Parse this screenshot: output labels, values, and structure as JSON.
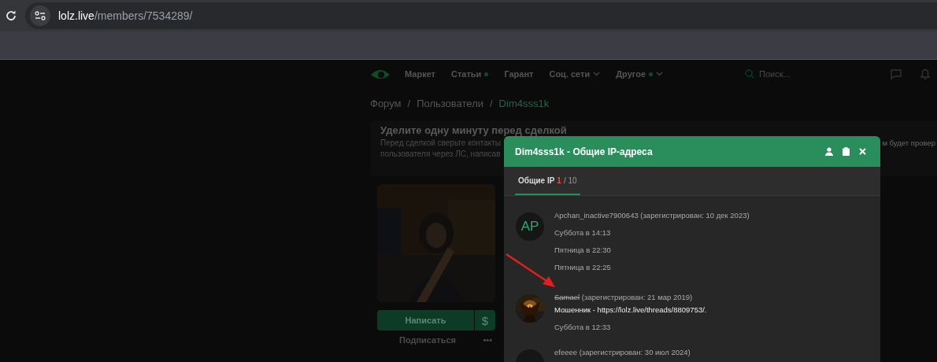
{
  "browser": {
    "url": {
      "host": "lolz.live",
      "path": "/members/7534289/"
    }
  },
  "site": {
    "nav": [
      {
        "label": "Маркет",
        "dot": false,
        "dropdown": false
      },
      {
        "label": "Статьи",
        "dot": true,
        "dropdown": false
      },
      {
        "label": "Гарант",
        "dot": false,
        "dropdown": false
      },
      {
        "label": "Соц. сети",
        "dot": false,
        "dropdown": true
      },
      {
        "label": "Другое",
        "dot": true,
        "dropdown": true
      }
    ],
    "search": {
      "placeholder": "Поиск..."
    },
    "breadcrumbs": [
      {
        "kind": "link",
        "label": "Форум",
        "selected": false
      },
      {
        "kind": "separator",
        "label": "/"
      },
      {
        "kind": "link",
        "label": "Пользователи",
        "selected": false
      },
      {
        "kind": "separator",
        "label": "/"
      },
      {
        "kind": "link",
        "label": "Dim4sss1k",
        "selected": true
      }
    ],
    "notice": {
      "title": "Уделите одну минуту перед сделкой",
      "lines": [
        {
          "left": "Перед сделкой сверьте контакты",
          "right": "м будет провер"
        },
        {
          "left": "пользователя через ЛС, написав"
        }
      ]
    },
    "profile": {
      "photo": {
        "kind": "picture"
      },
      "buttons": [
        {
          "label": "Написать",
          "kind": "primary"
        },
        {
          "label": "$",
          "kind": "side"
        },
        {
          "label": "Подписаться",
          "kind": "link"
        },
        {
          "label": "•••",
          "kind": "more"
        }
      ]
    }
  },
  "modal": {
    "title": "Dim4sss1k - Общие IP-адреса",
    "tabs": [
      {
        "label": "Общие IP",
        "count": "1",
        "total": "/ 10",
        "selected": true
      }
    ],
    "entries": [
      {
        "avatar": {
          "kind": "initials",
          "text": "AP"
        },
        "username": "Apchan_inactive7900643",
        "banned": false,
        "registered": "(зарегистрирован: 10 дек 2023)",
        "times": [
          "Суббота в 14:13",
          "Пятница в 22:30",
          "Пятница в 22:25"
        ]
      },
      {
        "avatar": {
          "kind": "picture"
        },
        "username": "Samael",
        "banned": true,
        "registered": "(зарегистрирован: 21 мар 2019)",
        "note": "Мошенник - https://lolz.live/threads/8809753/.",
        "times": [
          "Суббота в 12:33"
        ]
      },
      {
        "avatar": {
          "kind": "blank"
        },
        "username": "efeeee",
        "banned": false,
        "registered": "(зарегистрирован: 30 июл 2024)"
      }
    ]
  },
  "annotation": {
    "kind": "arrow",
    "color": "#e02020"
  }
}
